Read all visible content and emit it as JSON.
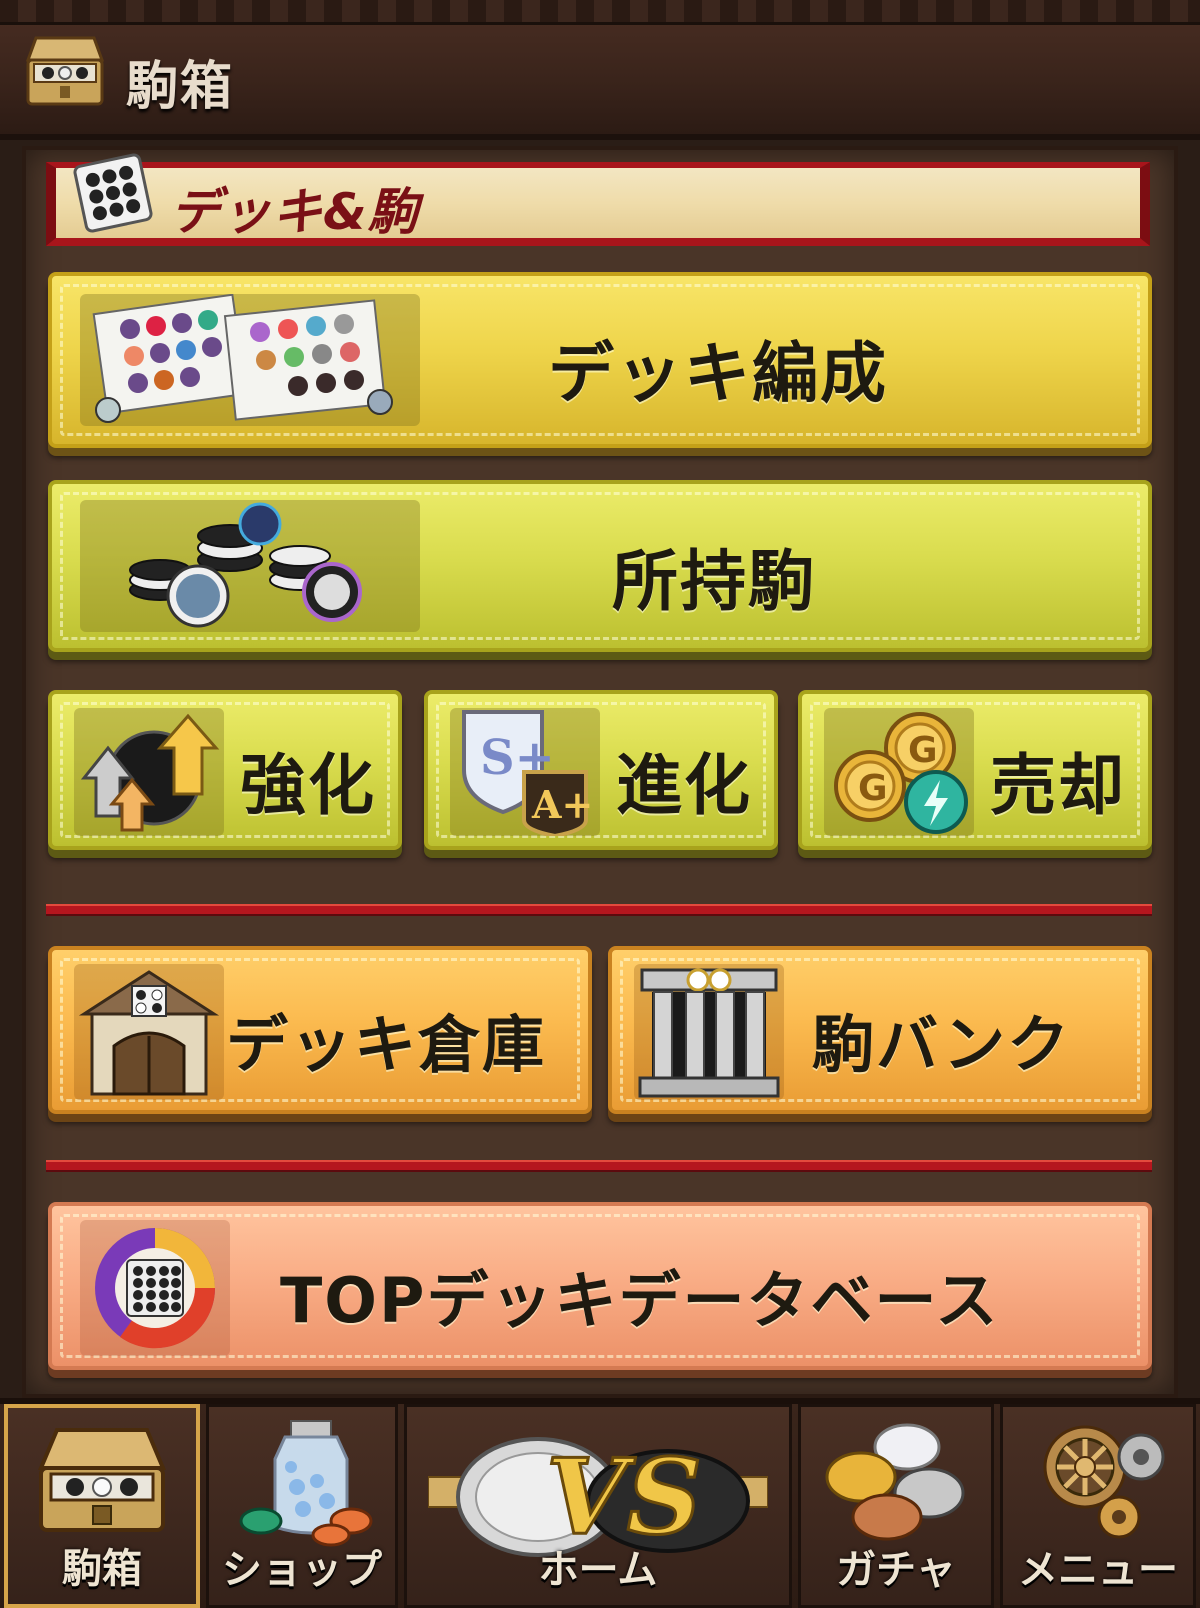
{
  "header": {
    "title": "駒箱"
  },
  "section": {
    "title": "デッキ&駒"
  },
  "menu": {
    "deck_edit": "デッキ編成",
    "owned_pieces": "所持駒",
    "enhance": "強化",
    "evolve": "進化",
    "sell": "売却",
    "deck_storage": "デッキ倉庫",
    "piece_bank": "駒バンク",
    "top_deck_db": "TOPデッキデータベース"
  },
  "evolve_icon": {
    "rank_s": "S+",
    "rank_a": "A+"
  },
  "sell_icon": {
    "coin_letter": "G"
  },
  "nav": {
    "items": [
      {
        "label": "駒箱",
        "icon": "chest-icon",
        "active": true
      },
      {
        "label": "ショップ",
        "icon": "shop-bottle-icon",
        "active": false
      },
      {
        "label": "ホーム",
        "icon": "vs-home-icon",
        "active": false
      },
      {
        "label": "ガチャ",
        "icon": "gacha-coins-icon",
        "active": false
      },
      {
        "label": "メニュー",
        "icon": "gear-menu-icon",
        "active": false
      }
    ],
    "vs_text": "VS"
  },
  "colors": {
    "banner_red": "#a8151b",
    "button_yellow": "#eed44a",
    "button_lime": "#d9dc4e",
    "button_orange": "#fbba4f",
    "button_salmon": "#f9ad86",
    "text_dark": "#1e1a10",
    "nav_active_border": "#d6a54a"
  }
}
